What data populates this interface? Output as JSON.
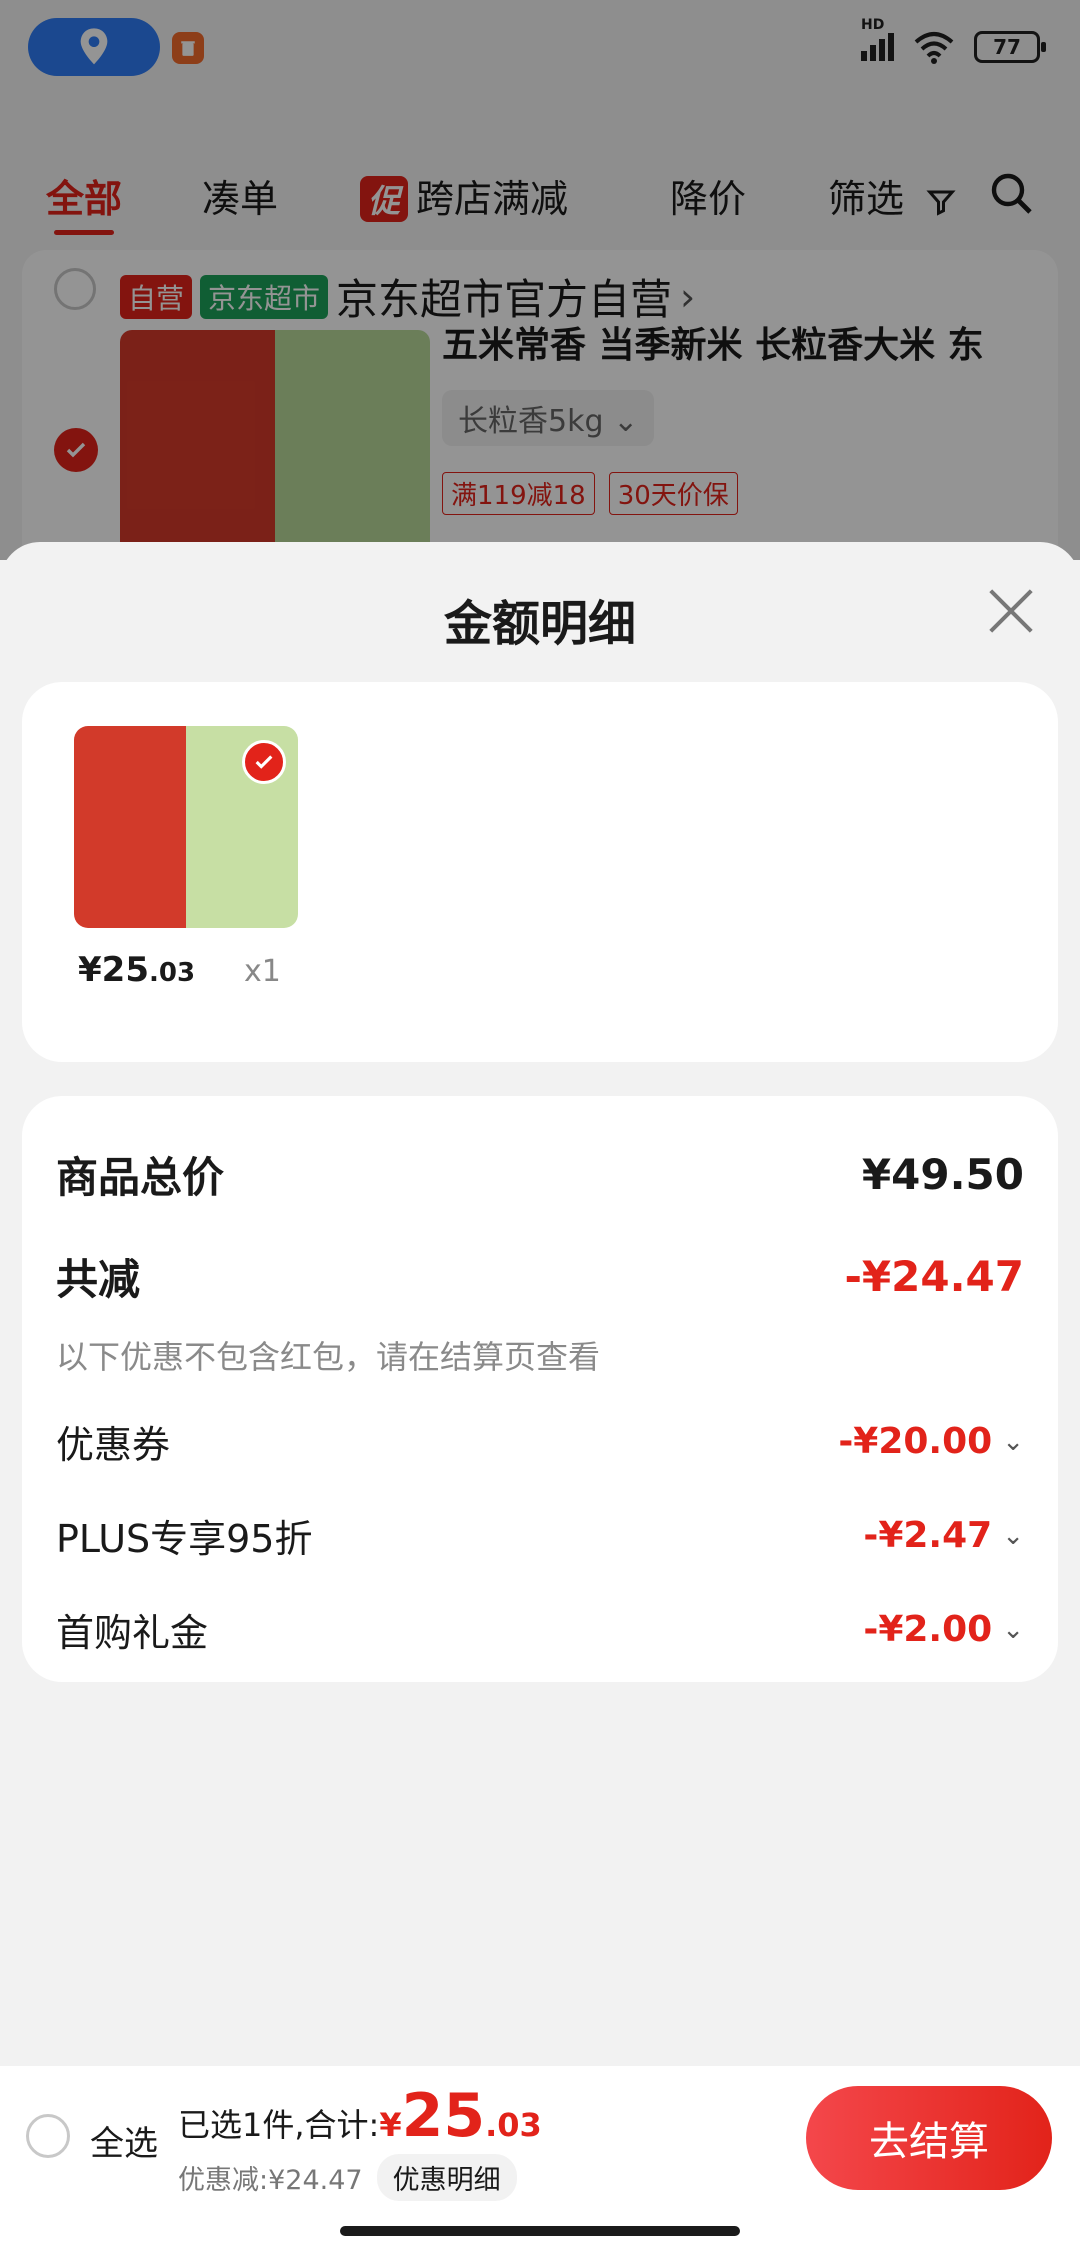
{
  "status_bar": {
    "hd_label": "HD",
    "battery_level": "77"
  },
  "filter_bar": {
    "tabs": [
      "全部",
      "凑单",
      "跨店满减",
      "降价",
      "筛选"
    ],
    "promo_tag": "促"
  },
  "shop": {
    "tag_self": "自营",
    "tag_market": "京东超市",
    "name": "京东超市官方自营",
    "product_title": "五米常香 当季新米 长粒香大米 东",
    "variant": "长粒香5kg",
    "promo_tags": [
      "满119减18",
      "30天价保"
    ]
  },
  "sheet": {
    "title": "金额明细",
    "items": [
      {
        "price_symbol": "¥",
        "price_int": "25",
        "price_dec": ".03",
        "qty": "x1"
      }
    ],
    "summary": {
      "total_label": "商品总价",
      "total_value": "¥49.50",
      "reduce_label": "共减",
      "reduce_value": "-¥24.47",
      "note": "以下优惠不包含红包，请在结算页查看",
      "discounts": [
        {
          "label": "优惠券",
          "value": "-¥20.00"
        },
        {
          "label": "PLUS专享95折",
          "value": "-¥2.47"
        },
        {
          "label": "首购礼金",
          "value": "-¥2.00"
        }
      ]
    }
  },
  "bottom_bar": {
    "select_all": "全选",
    "selected_text": "已选1件,合计:",
    "total_yen": "¥",
    "total_int": "25",
    "total_dec": ".03",
    "discount_text": "优惠减:¥24.47",
    "detail_button": "优惠明细",
    "checkout_button": "去结算"
  },
  "colors": {
    "accent_red": "#e2231a",
    "market_green": "#1da35a",
    "location_blue": "#2f7df6"
  }
}
